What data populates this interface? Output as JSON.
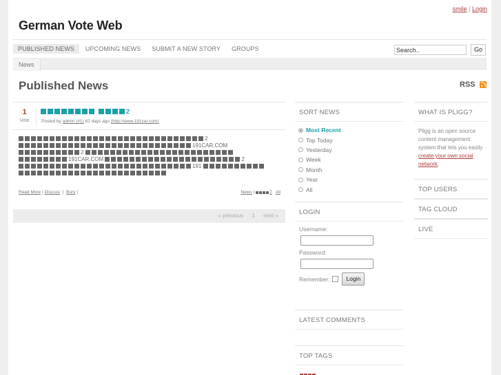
{
  "header": {
    "user_link": "smile",
    "separator": "|",
    "login_link": "Login",
    "site_title": "German Vote Web"
  },
  "nav": {
    "items": [
      {
        "label": "PUBLISHED NEWS",
        "active": true
      },
      {
        "label": "UPCOMING NEWS",
        "active": false
      },
      {
        "label": "SUBMIT A NEW STORY",
        "active": false
      },
      {
        "label": "GROUPS",
        "active": false
      }
    ],
    "search_value": "Search..",
    "go_label": "Go"
  },
  "subnav": {
    "items": [
      "News"
    ]
  },
  "main": {
    "title": "Published News",
    "rss_label": "RSS",
    "story": {
      "votes": "1",
      "vote_label": "Vote",
      "title_glyphs": 12,
      "title_suffix": "2",
      "meta_prefix": "Posted by",
      "author": "admin (#1)",
      "age": "62 days ago",
      "url": "(http://www.191car.com)",
      "body_fragments": [
        "2",
        "191CAR.COM",
        "2",
        "191CAR.COM",
        "2",
        "191"
      ],
      "read_more": "Read More",
      "discuss": "Discuss",
      "bury": "Bury",
      "category_link": "News",
      "category_suffix": "2",
      "all_link": "All"
    },
    "pager": {
      "previous": "« previous",
      "current": "1",
      "next": "next »"
    }
  },
  "sidebar": {
    "sort": {
      "heading": "SORT NEWS",
      "options": [
        {
          "label": "Most Recent",
          "selected": true
        },
        {
          "label": "Top Today",
          "selected": false
        },
        {
          "label": "Yesterday",
          "selected": false
        },
        {
          "label": "Week",
          "selected": false
        },
        {
          "label": "Month",
          "selected": false
        },
        {
          "label": "Year",
          "selected": false
        },
        {
          "label": "All",
          "selected": false
        }
      ]
    },
    "login": {
      "heading": "LOGIN",
      "username_label": "Username:",
      "username_value": "",
      "password_label": "Password:",
      "password_value": "",
      "remember_label": "Remember:",
      "button_label": "Login"
    },
    "latest_comments": {
      "heading": "LATEST COMMENTS"
    },
    "top_tags": {
      "heading": "TOP TAGS"
    },
    "what_is_pligg": {
      "heading": "WHAT IS PLIGG?",
      "text": "Pligg is an open source content management system that lets you easily ",
      "link": "create your own social network",
      "after": "."
    },
    "top_users": {
      "heading": "TOP USERS"
    },
    "tag_cloud": {
      "heading": "TAG CLOUD"
    },
    "live": {
      "heading": "LIVE"
    }
  },
  "colors": {
    "accent_teal": "#1aa0a8",
    "link_red": "#b03a3a",
    "rss_orange": "#f7931e"
  }
}
